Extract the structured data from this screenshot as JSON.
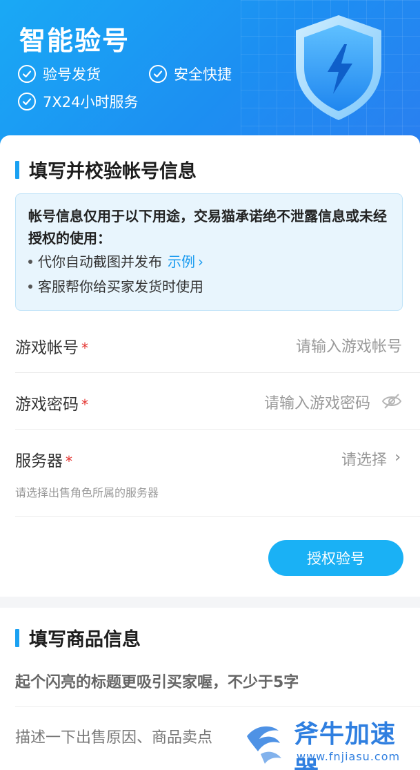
{
  "hero": {
    "title": "智能验号",
    "features": [
      "验号发货",
      "安全快捷",
      "7X24小时服务"
    ]
  },
  "account_section": {
    "title": "填写并校验帐号信息",
    "notice": {
      "lead": "帐号信息仅用于以下用途，交易猫承诺绝不泄露信息或未经授权的使用：",
      "bullet_1": "代你自动截图并发布",
      "bullet_1_link": "示例",
      "bullet_2": "客服帮你给买家发货时使用"
    },
    "fields": {
      "account": {
        "label": "游戏帐号",
        "required": "*",
        "placeholder": "请输入游戏帐号"
      },
      "password": {
        "label": "游戏密码",
        "required": "*",
        "placeholder": "请输入游戏密码"
      },
      "server": {
        "label": "服务器",
        "required": "*",
        "value": "请选择",
        "hint": "请选择出售角色所属的服务器"
      }
    },
    "auth_button": "授权验号"
  },
  "product_section": {
    "title": "填写商品信息",
    "title_placeholder": "起个闪亮的标题更吸引买家喔，不少于5字",
    "desc_placeholder": "描述一下出售原因、商品卖点"
  },
  "watermark": {
    "brand": "斧牛加速器",
    "url": "www.fnjiasu.com"
  },
  "colors": {
    "accent": "#1ab1f5",
    "hero_bg": "#1c8ff2",
    "required": "#e3312d",
    "link": "#1a9bf0"
  }
}
